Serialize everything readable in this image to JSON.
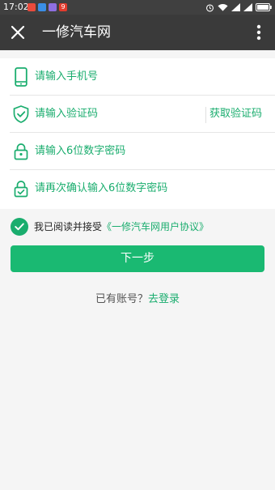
{
  "colors": {
    "accent": "#1aad6e",
    "button": "#1ab972",
    "app_bar": "#3a3a3a",
    "status_bar": "#404040"
  },
  "status_bar": {
    "time": "17:02",
    "app_badge_text": "9",
    "icons": [
      "notification-app-icon",
      "notification-app-icon",
      "notification-app-icon",
      "notification-app-icon",
      "alarm-icon",
      "wifi-icon",
      "signal-icon",
      "signal-icon",
      "battery-icon"
    ]
  },
  "app_bar": {
    "title": "一修汽车网",
    "close_icon": "close-icon",
    "more_icon": "more-vertical-icon"
  },
  "form": {
    "phone": {
      "placeholder": "请输入手机号",
      "icon": "phone-icon"
    },
    "code": {
      "placeholder": "请输入验证码",
      "icon": "shield-check-icon",
      "get_code_label": "获取验证码"
    },
    "password": {
      "placeholder": "请输入6位数字密码",
      "icon": "lock-icon"
    },
    "confirm_password": {
      "placeholder": "请再次确认输入6位数字密码",
      "icon": "lock-check-icon"
    }
  },
  "agreement": {
    "checked": true,
    "text": "我已阅读并接受",
    "link": "《一修汽车网用户协议》"
  },
  "next_button": {
    "label": "下一步"
  },
  "login_prompt": {
    "text": "已有账号？",
    "link": "去登录"
  }
}
